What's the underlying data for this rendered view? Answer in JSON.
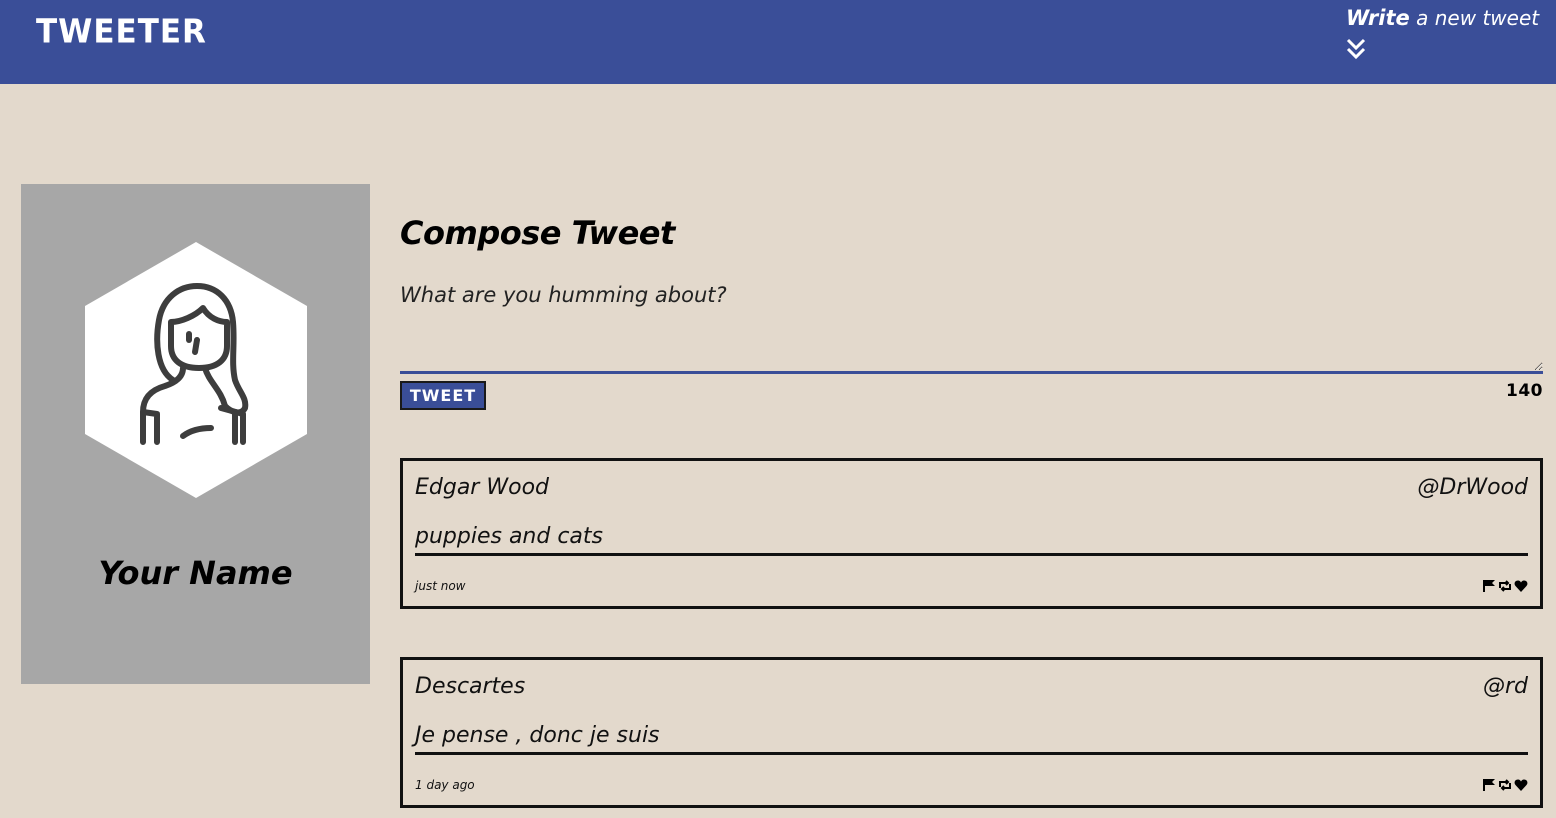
{
  "nav": {
    "brand": "TWEETER",
    "write_bold": "Write",
    "write_rest": " a new tweet",
    "toggle_icon": "double-chevron-down-icon"
  },
  "profile": {
    "avatar_icon": "user-avatar-icon",
    "name": "Your Name"
  },
  "compose": {
    "title": "Compose Tweet",
    "placeholder": "What are you humming about?",
    "value": "",
    "button_label": "TWEET",
    "counter": "140"
  },
  "tweets": [
    {
      "author": "Edgar Wood",
      "handle": "@DrWood",
      "text": "puppies and cats",
      "time": "just now"
    },
    {
      "author": "Descartes",
      "handle": "@rd",
      "text": "Je pense , donc je suis",
      "time": "1 day ago"
    }
  ],
  "tweet_actions": [
    "flag-icon",
    "retweet-icon",
    "heart-icon"
  ],
  "colors": {
    "accent": "#3a4e98",
    "background": "#e3d9cc",
    "profile_bg": "#a7a7a7",
    "border": "#111111"
  }
}
